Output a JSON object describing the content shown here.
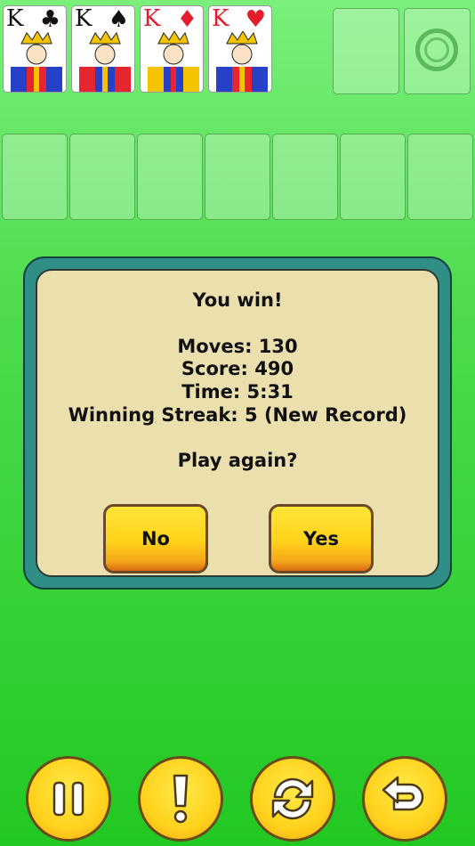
{
  "cards": [
    {
      "rank": "K",
      "suit_glyph": "♣",
      "color": "black"
    },
    {
      "rank": "K",
      "suit_glyph": "♠",
      "color": "black"
    },
    {
      "rank": "K",
      "suit_glyph": "♦",
      "color": "red"
    },
    {
      "rank": "K",
      "suit_glyph": "♥",
      "color": "red"
    }
  ],
  "dialog": {
    "title": "You win!",
    "moves": "Moves: 130",
    "score": "Score: 490",
    "time": "Time: 5:31",
    "streak": "Winning Streak: 5 (New Record)",
    "prompt": "Play again?",
    "no_label": "No",
    "yes_label": "Yes"
  },
  "toolbar": {
    "icons": [
      "pause-icon",
      "hint-icon",
      "restart-icon",
      "undo-icon"
    ]
  },
  "colors": {
    "felt_top": "#7af07a",
    "felt_bottom": "#22c822",
    "dialog_frame": "#2f8f86",
    "dialog_panel": "#ecdfae",
    "button_yellow": "#ffd21a"
  }
}
